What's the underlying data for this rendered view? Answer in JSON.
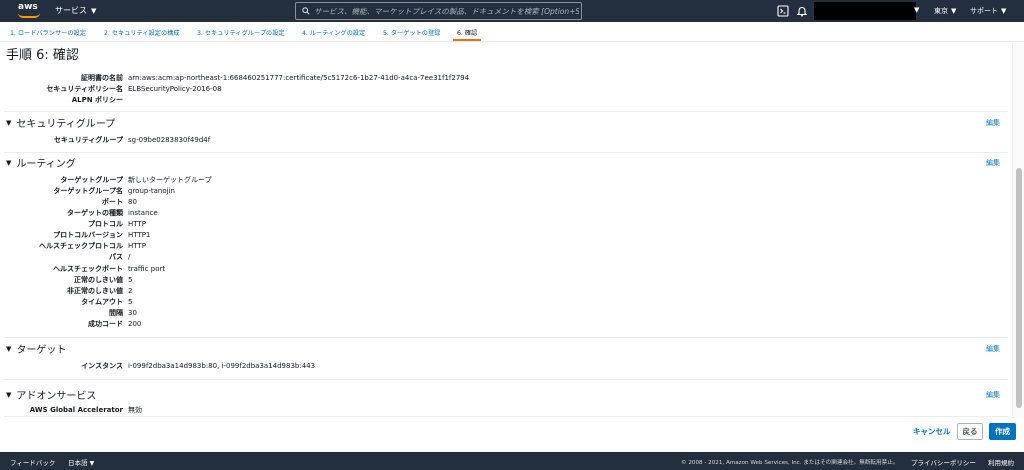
{
  "nav": {
    "logo": "aws",
    "services": "サービス",
    "search_placeholder": "サービス、機能、マーケットプレイスの製品、ドキュメントを検索 [Option+S]",
    "region": "東京",
    "support": "サポート"
  },
  "steps": [
    "1. ロードバランサーの設定",
    "2. セキュリティ設定の構成",
    "3. セキュリティグループの設定",
    "4. ルーティングの設定",
    "5. ターゲットの登録",
    "6. 確認"
  ],
  "page_title": "手順 6: 確認",
  "security_settings": {
    "rows": [
      {
        "label": "証明書の名前",
        "value": "arn:aws:acm:ap-northeast-1:668460251777:certificate/5c5172c6-1b27-41d0-a4ca-7ee31f1f2794"
      },
      {
        "label": "セキュリティポリシー名",
        "value": "ELBSecurityPolicy-2016-08"
      },
      {
        "label": "ALPN ポリシー",
        "value": ""
      }
    ]
  },
  "security_group": {
    "title": "セキュリティグループ",
    "edit": "編集",
    "rows": [
      {
        "label": "セキュリティグループ",
        "value": "sg-09be0283830f49d4f"
      }
    ]
  },
  "routing": {
    "title": "ルーティング",
    "edit": "編集",
    "rows": [
      {
        "label": "ターゲットグループ",
        "value": "新しいターゲットグループ"
      },
      {
        "label": "ターゲットグループ名",
        "value": "group-tanojin"
      },
      {
        "label": "ポート",
        "value": "80"
      },
      {
        "label": "ターゲットの種類",
        "value": "instance"
      },
      {
        "label": "プロトコル",
        "value": "HTTP"
      },
      {
        "label": "プロトコルバージョン",
        "value": "HTTP1"
      },
      {
        "label": "ヘルスチェックプロトコル",
        "value": "HTTP"
      },
      {
        "label": "パス",
        "value": "/"
      },
      {
        "label": "ヘルスチェックポート",
        "value": "traffic port"
      },
      {
        "label": "正常のしきい値",
        "value": "5"
      },
      {
        "label": "非正常のしきい値",
        "value": "2"
      },
      {
        "label": "タイムアウト",
        "value": "5"
      },
      {
        "label": "間隔",
        "value": "30"
      },
      {
        "label": "成功コード",
        "value": "200"
      }
    ]
  },
  "targets": {
    "title": "ターゲット",
    "edit": "編集",
    "rows": [
      {
        "label": "インスタンス",
        "value": "i-099f2dba3a14d983b:80, i-099f2dba3a14d983b:443"
      }
    ]
  },
  "addons": {
    "title": "アドオンサービス",
    "edit": "編集",
    "rows": [
      {
        "label": "AWS Global Accelerator",
        "value": "無効"
      }
    ]
  },
  "actions": {
    "cancel": "キャンセル",
    "back": "戻る",
    "create": "作成"
  },
  "footer": {
    "feedback": "フィードバック",
    "language": "日本語",
    "copyright": "© 2008 - 2021, Amazon Web Services, Inc. またはその関連会社。無断転用禁止。",
    "privacy": "プライバシーポリシー",
    "terms": "利用規約"
  }
}
